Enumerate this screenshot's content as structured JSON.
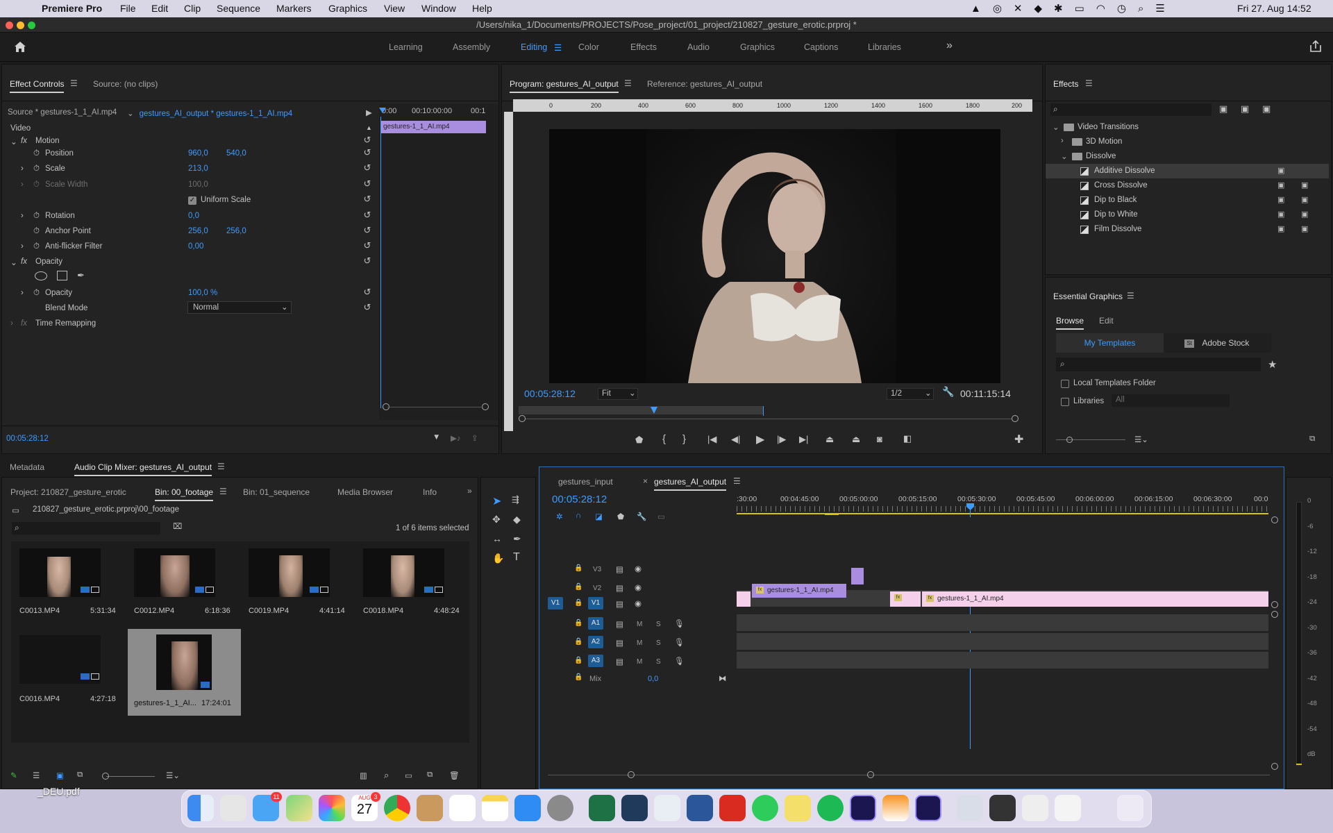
{
  "menubar": {
    "app": "Premiere Pro",
    "items": [
      "File",
      "Edit",
      "Clip",
      "Sequence",
      "Markers",
      "Graphics",
      "View",
      "Window",
      "Help"
    ],
    "datetime": "Fri 27. Aug  14:52"
  },
  "window": {
    "title": "/Users/nika_1/Documents/PROJECTS/Pose_project/01_project/210827_gesture_erotic.prproj *"
  },
  "workspaces": {
    "items": [
      "Learning",
      "Assembly",
      "Editing",
      "Color",
      "Effects",
      "Audio",
      "Graphics",
      "Captions",
      "Libraries"
    ],
    "active": "Editing",
    "overflow": "»"
  },
  "effect_controls": {
    "tabs": [
      "Effect Controls",
      "Source: (no clips)"
    ],
    "source_label": "Source * gestures-1_1_AI.mp4",
    "sequence_label": "gestures_AI_output * gestures-1_1_AI.mp4",
    "mini_timecodes": [
      "0:00",
      "00:10:00:00",
      "00:1"
    ],
    "mini_clip": "gestures-1_1_AI.mp4",
    "section_video": "Video",
    "motion": "Motion",
    "position": {
      "label": "Position",
      "x": "960,0",
      "y": "540,0"
    },
    "scale": {
      "label": "Scale",
      "value": "213,0"
    },
    "scale_width": {
      "label": "Scale Width",
      "value": "100,0"
    },
    "uniform_scale": "Uniform Scale",
    "rotation": {
      "label": "Rotation",
      "value": "0,0"
    },
    "anchor_point": {
      "label": "Anchor Point",
      "x": "256,0",
      "y": "256,0"
    },
    "anti_flicker": {
      "label": "Anti-flicker Filter",
      "value": "0,00"
    },
    "opacity_group": "Opacity",
    "opacity": {
      "label": "Opacity",
      "value": "100,0 %"
    },
    "blend_mode": {
      "label": "Blend Mode",
      "value": "Normal"
    },
    "time_remapping": "Time Remapping",
    "timecode": "00:05:28:12"
  },
  "program_monitor": {
    "tabs": [
      "Program: gestures_AI_output",
      "Reference: gestures_AI_output"
    ],
    "ruler_labels": [
      "0",
      "200",
      "400",
      "600",
      "800",
      "1000",
      "1200",
      "1400",
      "1600",
      "1800",
      "200"
    ],
    "timecode": "00:05:28:12",
    "fit": "Fit",
    "resolution": "1/2",
    "duration": "00:11:15:14"
  },
  "effects_panel": {
    "title": "Effects",
    "tree": [
      {
        "label": "Video Transitions",
        "level": 0,
        "type": "folder",
        "open": true
      },
      {
        "label": "3D Motion",
        "level": 1,
        "type": "folder",
        "open": false
      },
      {
        "label": "Dissolve",
        "level": 1,
        "type": "folder",
        "open": true
      },
      {
        "label": "Additive Dissolve",
        "level": 2,
        "type": "effect",
        "selected": true
      },
      {
        "label": "Cross Dissolve",
        "level": 2,
        "type": "effect"
      },
      {
        "label": "Dip to Black",
        "level": 2,
        "type": "effect"
      },
      {
        "label": "Dip to White",
        "level": 2,
        "type": "effect"
      },
      {
        "label": "Film Dissolve",
        "level": 2,
        "type": "effect"
      }
    ]
  },
  "essential_graphics": {
    "title": "Essential Graphics",
    "tabs": [
      "Browse",
      "Edit"
    ],
    "sub_tabs": [
      "My Templates",
      "Adobe Stock"
    ],
    "local_templates": "Local Templates Folder",
    "libraries": "Libraries",
    "libraries_select": "All"
  },
  "lower_left_tabs": [
    "Metadata",
    "Audio Clip Mixer: gestures_AI_output"
  ],
  "project_panel": {
    "tabs": [
      "Project: 210827_gesture_erotic",
      "Bin: 00_footage",
      "Bin: 01_sequence",
      "Media Browser",
      "Info"
    ],
    "path": "210827_gesture_erotic.prproj\\00_footage",
    "selection": "1 of 6 items selected",
    "items": [
      {
        "name": "C0013.MP4",
        "duration": "5:31:34"
      },
      {
        "name": "C0012.MP4",
        "duration": "6:18:36"
      },
      {
        "name": "C0019.MP4",
        "duration": "4:41:14"
      },
      {
        "name": "C0018.MP4",
        "duration": "4:48:24"
      },
      {
        "name": "C0016.MP4",
        "duration": "4:27:18"
      },
      {
        "name": "gestures-1_1_AI...",
        "duration": "17:24:01"
      }
    ]
  },
  "timeline": {
    "tabs": [
      "gestures_input",
      "gestures_AI_output"
    ],
    "timecode": "00:05:28:12",
    "ruler": [
      ":30:00",
      "00:04:45:00",
      "00:05:00:00",
      "00:05:15:00",
      "00:05:30:00",
      "00:05:45:00",
      "00:06:00:00",
      "00:06:15:00",
      "00:06:30:00",
      "00:0"
    ],
    "tracks": {
      "video": [
        "V3",
        "V2",
        "V1"
      ],
      "audio": [
        "A1",
        "A2",
        "A3"
      ],
      "mix_label": "Mix",
      "mix_value": "0,0",
      "source_patch": "V1",
      "m": "M",
      "s": "S"
    },
    "clips": {
      "v2": "gestures-1_1_AI.mp4",
      "v1": "gestures-1_1_AI.mp4",
      "fx": "fx"
    }
  },
  "audio_meter": {
    "labels": [
      "0",
      "-6",
      "-12",
      "-18",
      "-24",
      "-30",
      "-36",
      "-42",
      "-48",
      "-54",
      "dB"
    ]
  },
  "desktop": {
    "file_label": "_DEU.pdf",
    "calendar_month": "AUG",
    "calendar_day": "27",
    "mail_badge": "11",
    "calendar_badge": "3"
  }
}
